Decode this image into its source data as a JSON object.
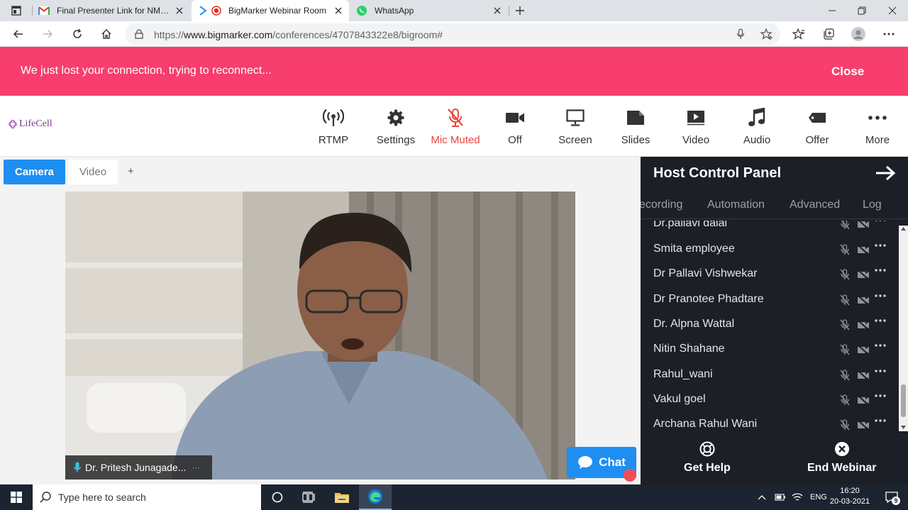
{
  "browser": {
    "tabs": [
      {
        "title": "Final Presenter Link for NMOGS"
      },
      {
        "title": "BigMarker Webinar Room"
      },
      {
        "title": "WhatsApp"
      }
    ],
    "url": {
      "scheme": "https://",
      "host": "www.bigmarker.com",
      "path": "/conferences/4707843322e8/bigroom#"
    }
  },
  "banner": {
    "message": "We just lost your connection, trying to reconnect...",
    "close_label": "Close",
    "color": "#f73e6e"
  },
  "app": {
    "logo_text": "LifeCell",
    "toolbar": [
      {
        "label": "RTMP",
        "icon": "broadcast-icon"
      },
      {
        "label": "Settings",
        "icon": "gear-icon"
      },
      {
        "label": "Mic Muted",
        "icon": "mic-off-icon"
      },
      {
        "label": "Off",
        "icon": "camera-icon"
      },
      {
        "label": "Screen",
        "icon": "monitor-icon"
      },
      {
        "label": "Slides",
        "icon": "slides-icon"
      },
      {
        "label": "Video",
        "icon": "play-video-icon"
      },
      {
        "label": "Audio",
        "icon": "music-note-icon"
      },
      {
        "label": "Offer",
        "icon": "tag-icon"
      },
      {
        "label": "More",
        "icon": "more-dots-icon"
      }
    ],
    "accent_color": "#1f8ef1",
    "muted_color": "#e8453c"
  },
  "stage": {
    "tabs": {
      "camera": "Camera",
      "video": "Video",
      "add": "+"
    },
    "presenter_name": "Dr. Pritesh Junagade...",
    "chat_label": "Chat"
  },
  "panel": {
    "title": "Host Control Panel",
    "tabs": [
      "ecording",
      "Automation",
      "Advanced",
      "Log"
    ],
    "partial_top": "Dr.pallavi dalal",
    "attendees": [
      "Smita employee",
      "Dr Pallavi Vishwekar",
      "Dr Pranotee Phadtare",
      "Dr. Alpna Wattal",
      "Nitin Shahane",
      "Rahul_wani",
      "Vakul goel",
      "Archana Rahul Wani"
    ],
    "footer": {
      "help": "Get Help",
      "end": "End Webinar"
    }
  },
  "taskbar": {
    "search_placeholder": "Type here to search",
    "lang": "ENG",
    "time": "16:20",
    "date": "20-03-2021",
    "notifications": "9"
  }
}
